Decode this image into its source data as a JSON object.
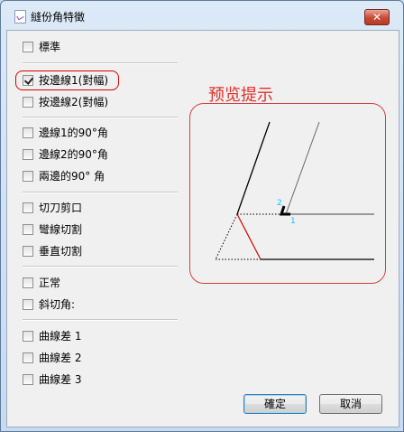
{
  "window": {
    "title": "縫份角特徵",
    "close_glyph": "✕"
  },
  "options": [
    {
      "label": "標準",
      "checked": false
    },
    {
      "label": "按邊線1(對幅)",
      "checked": true
    },
    {
      "label": "按邊線2(對幅)",
      "checked": false
    },
    {
      "label": "邊線1的90°角",
      "checked": false
    },
    {
      "label": "邊線2的90°角",
      "checked": false
    },
    {
      "label": "兩邊的90° 角",
      "checked": false
    },
    {
      "label": "切刀剪口",
      "checked": false
    },
    {
      "label": "彎線切割",
      "checked": false
    },
    {
      "label": "垂直切割",
      "checked": false
    },
    {
      "label": "正常",
      "checked": false
    },
    {
      "label": "斜切角:",
      "checked": false
    },
    {
      "label": "曲線差 1",
      "checked": false
    },
    {
      "label": "曲線差 2",
      "checked": false
    },
    {
      "label": "曲線差 3",
      "checked": false
    }
  ],
  "preview": {
    "title": "预览提示",
    "marker_1": "1",
    "marker_2": "2"
  },
  "buttons": {
    "ok": "確定",
    "cancel": "取消"
  },
  "colors": {
    "highlight": "#d80000",
    "marker": "#00c8ff",
    "preview_title": "#e0302a"
  }
}
